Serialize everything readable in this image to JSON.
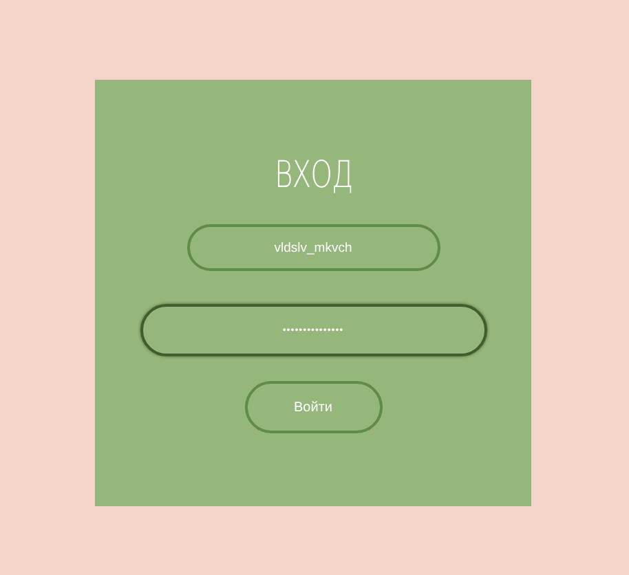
{
  "title": "ВХОД",
  "fields": [
    {
      "kind": "text",
      "value": "vldslv_mkvch",
      "focused": false
    },
    {
      "kind": "password",
      "value": "•••••••••••••••",
      "focused": true
    }
  ],
  "button": "Войти"
}
